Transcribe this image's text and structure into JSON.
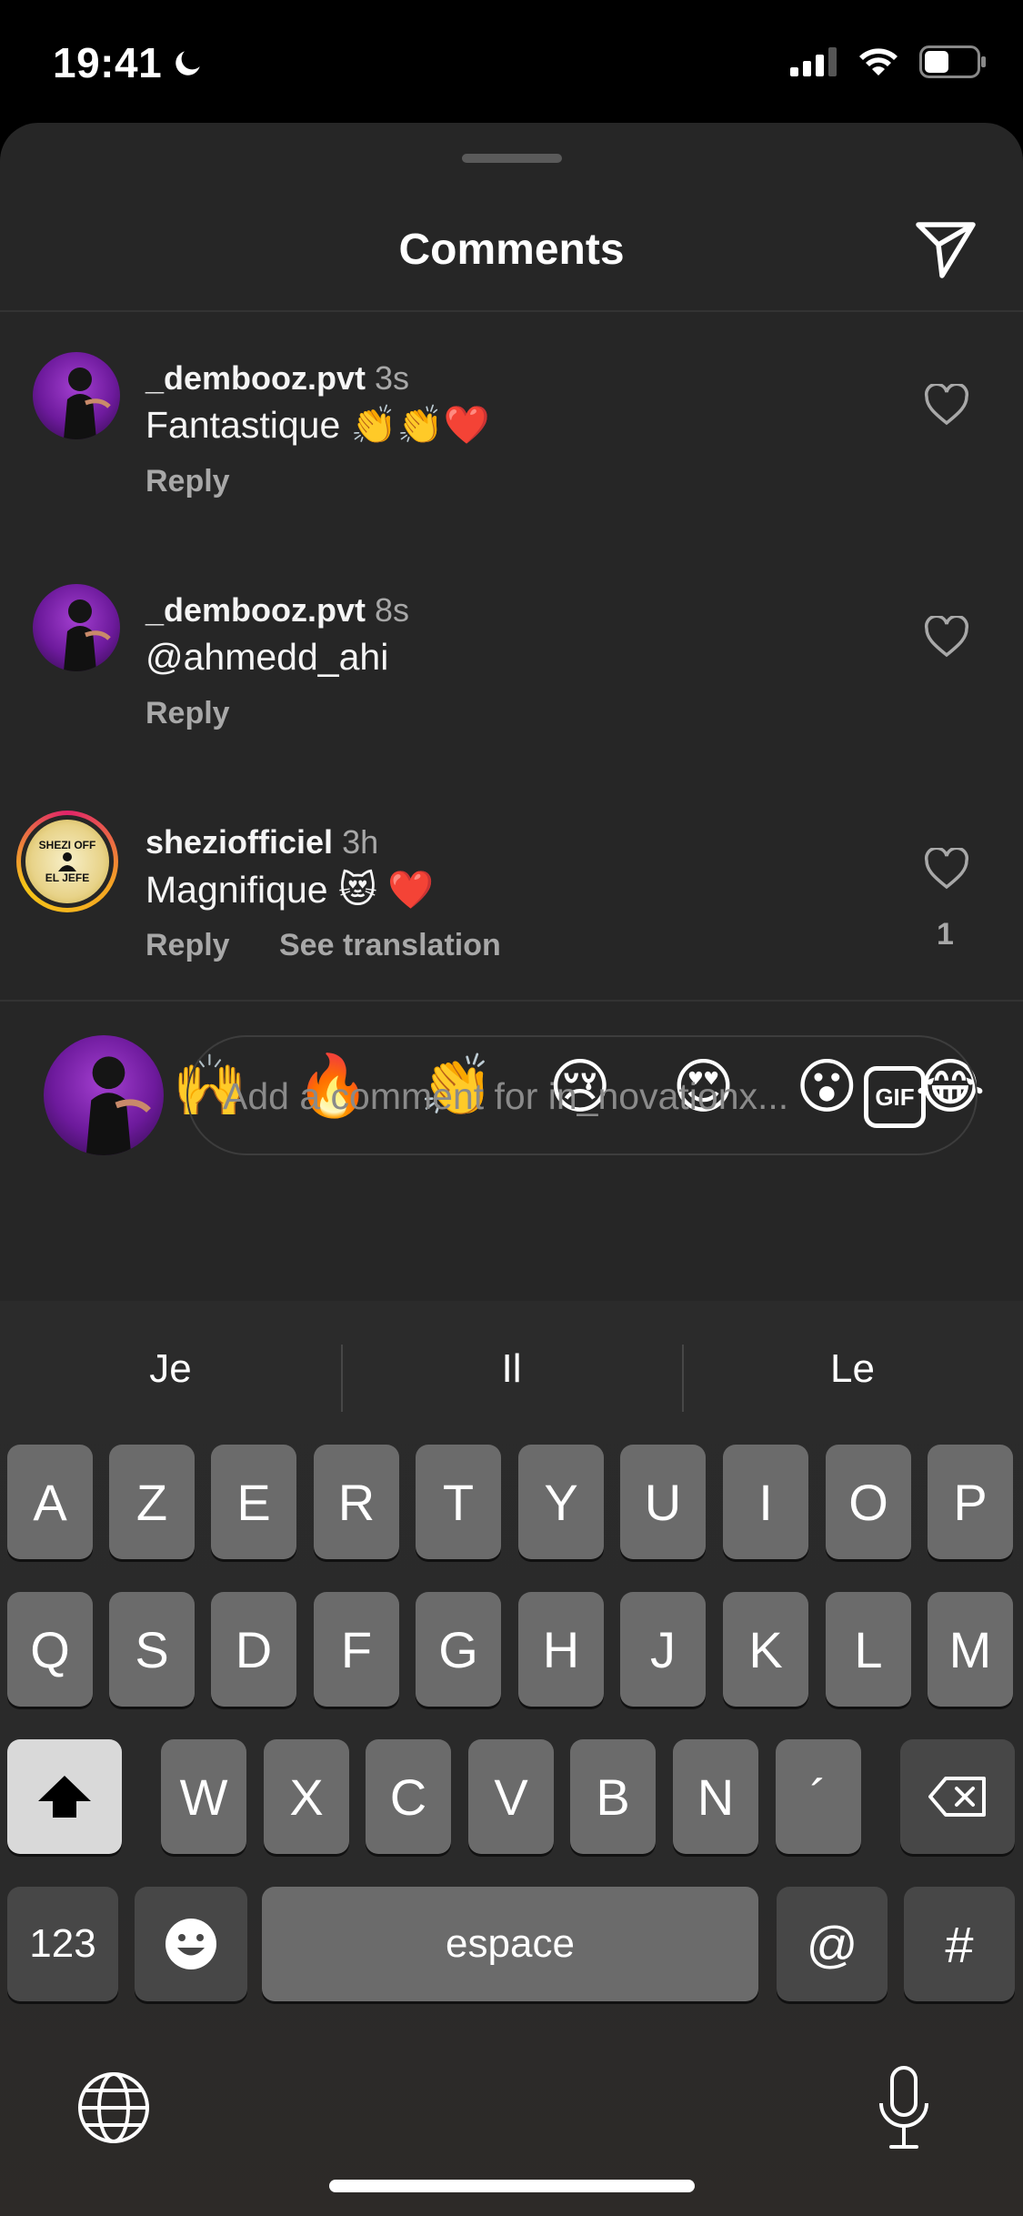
{
  "status_bar": {
    "time": "19:41"
  },
  "sheet": {
    "title": "Comments",
    "comments": [
      {
        "username": "_dembooz.pvt",
        "time": "3s",
        "text": "Fantastique 👏👏❤️",
        "reply": "Reply"
      },
      {
        "username": "_dembooz.pvt",
        "time": "8s",
        "text": "@ahmedd_ahi",
        "reply": "Reply"
      },
      {
        "username": "sheziofficiel",
        "time": "3h",
        "text": "Magnifique 😻 ❤️",
        "reply": "Reply",
        "see_translation": "See translation",
        "likes": "1"
      }
    ],
    "reactions": [
      "❤️",
      "🙌",
      "🔥",
      "👏",
      "😢",
      "😍",
      "😮",
      "😂"
    ],
    "comment_input": {
      "placeholder": "Add a comment for in_novationx...",
      "gif_label": "GIF"
    },
    "avatar_logo_text": [
      "SHEZI OFF",
      "EL JEFE"
    ]
  },
  "keyboard": {
    "suggestions": [
      "Je",
      "Il",
      "Le"
    ],
    "row1": [
      "A",
      "Z",
      "E",
      "R",
      "T",
      "Y",
      "U",
      "I",
      "O",
      "P"
    ],
    "row2": [
      "Q",
      "S",
      "D",
      "F",
      "G",
      "H",
      "J",
      "K",
      "L",
      "M"
    ],
    "row3": [
      "W",
      "X",
      "C",
      "V",
      "B",
      "N",
      "´"
    ],
    "numbers_label": "123",
    "space_label": "espace",
    "at_label": "@",
    "hash_label": "#"
  }
}
